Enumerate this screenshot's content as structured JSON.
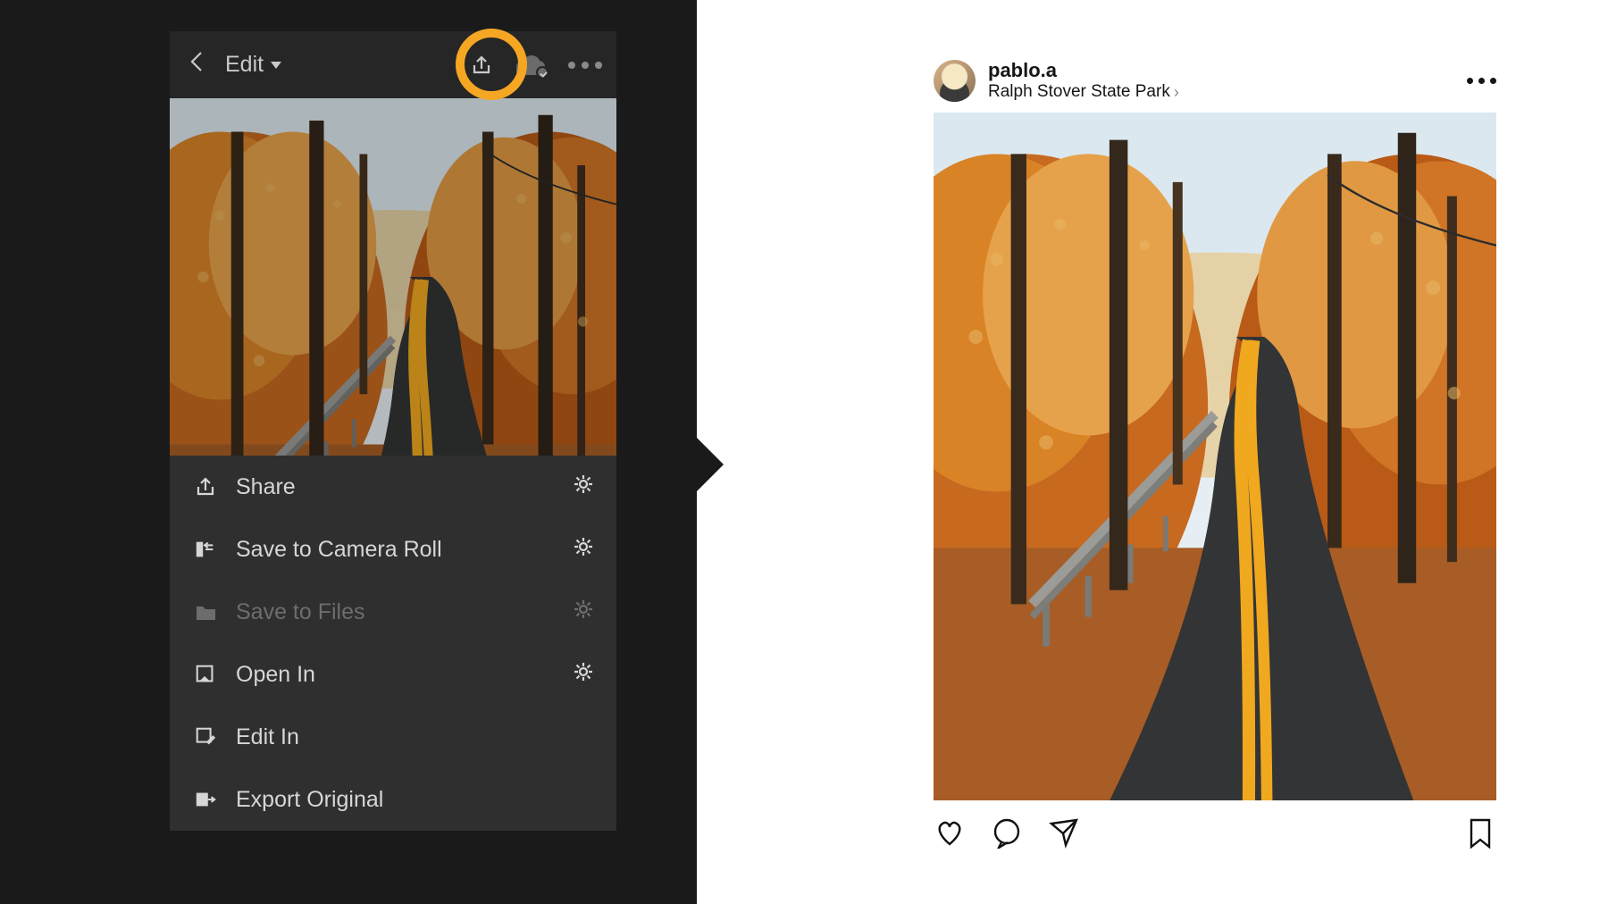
{
  "lightroom": {
    "header": {
      "mode_label": "Edit",
      "icons": {
        "share": "share-icon",
        "cloud": "cloud-sync-icon",
        "more": "more-icon"
      }
    },
    "share_menu": [
      {
        "key": "share",
        "label": "Share",
        "icon": "share-icon",
        "has_gear": true,
        "disabled": false
      },
      {
        "key": "camera-roll",
        "label": "Save to Camera Roll",
        "icon": "save-roll-icon",
        "has_gear": true,
        "disabled": false
      },
      {
        "key": "files",
        "label": "Save to Files",
        "icon": "folder-icon",
        "has_gear": true,
        "disabled": true
      },
      {
        "key": "open-in",
        "label": "Open In",
        "icon": "open-in-icon",
        "has_gear": true,
        "disabled": false
      },
      {
        "key": "edit-in",
        "label": "Edit In",
        "icon": "edit-in-icon",
        "has_gear": false,
        "disabled": false
      },
      {
        "key": "export-orig",
        "label": "Export Original",
        "icon": "export-icon",
        "has_gear": false,
        "disabled": false
      }
    ],
    "highlight_ring_color": "#f5a623"
  },
  "instagram": {
    "username": "pablo.a",
    "location": "Ralph Stover State Park",
    "actions": {
      "like": "heart-icon",
      "comment": "comment-icon",
      "send": "send-icon",
      "save": "bookmark-icon"
    }
  },
  "photo_scene": "autumn-road-through-forest"
}
